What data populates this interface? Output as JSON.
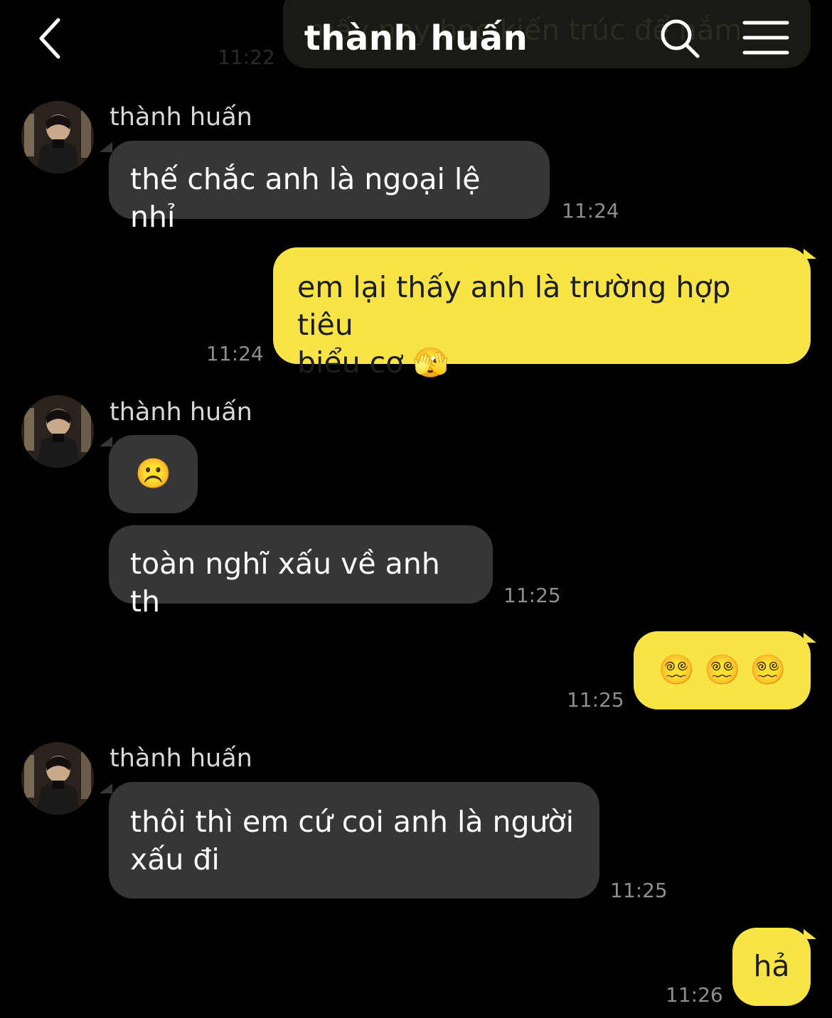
{
  "header": {
    "title": "thành huấn",
    "prev_message_text": "mấy nay học kiến trúc để nắm",
    "prev_message_time": "11:22",
    "back_icon": "chevron-left-icon",
    "search_icon": "search-icon",
    "menu_icon": "hamburger-menu-icon"
  },
  "colors": {
    "background": "#000000",
    "incoming_bubble": "#363638",
    "outgoing_bubble": "#f8e446",
    "timestamp": "#8e8e8e"
  },
  "messages": [
    {
      "sender": "thành huấn",
      "text": "thế chắc anh là ngoại lệ nhỉ",
      "time": "11:24",
      "direction": "in"
    },
    {
      "text_line1": "em lại thấy anh là trường hợp tiêu",
      "text_line2": "biểu cơ",
      "emoji": "🫣",
      "time": "11:24",
      "direction": "out"
    },
    {
      "sender": "thành huấn",
      "emoji": "☹️",
      "direction": "in"
    },
    {
      "text": "toàn nghĩ xấu về anh th",
      "time": "11:25",
      "direction": "in"
    },
    {
      "emojis": "😵‍💫 😵‍💫 😵‍💫",
      "time": "11:25",
      "direction": "out"
    },
    {
      "sender": "thành huấn",
      "text_line1": "thôi thì em cứ coi anh là người",
      "text_line2": "xấu đi",
      "time": "11:25",
      "direction": "in"
    },
    {
      "text": "hả",
      "time": "11:26",
      "direction": "out"
    }
  ]
}
